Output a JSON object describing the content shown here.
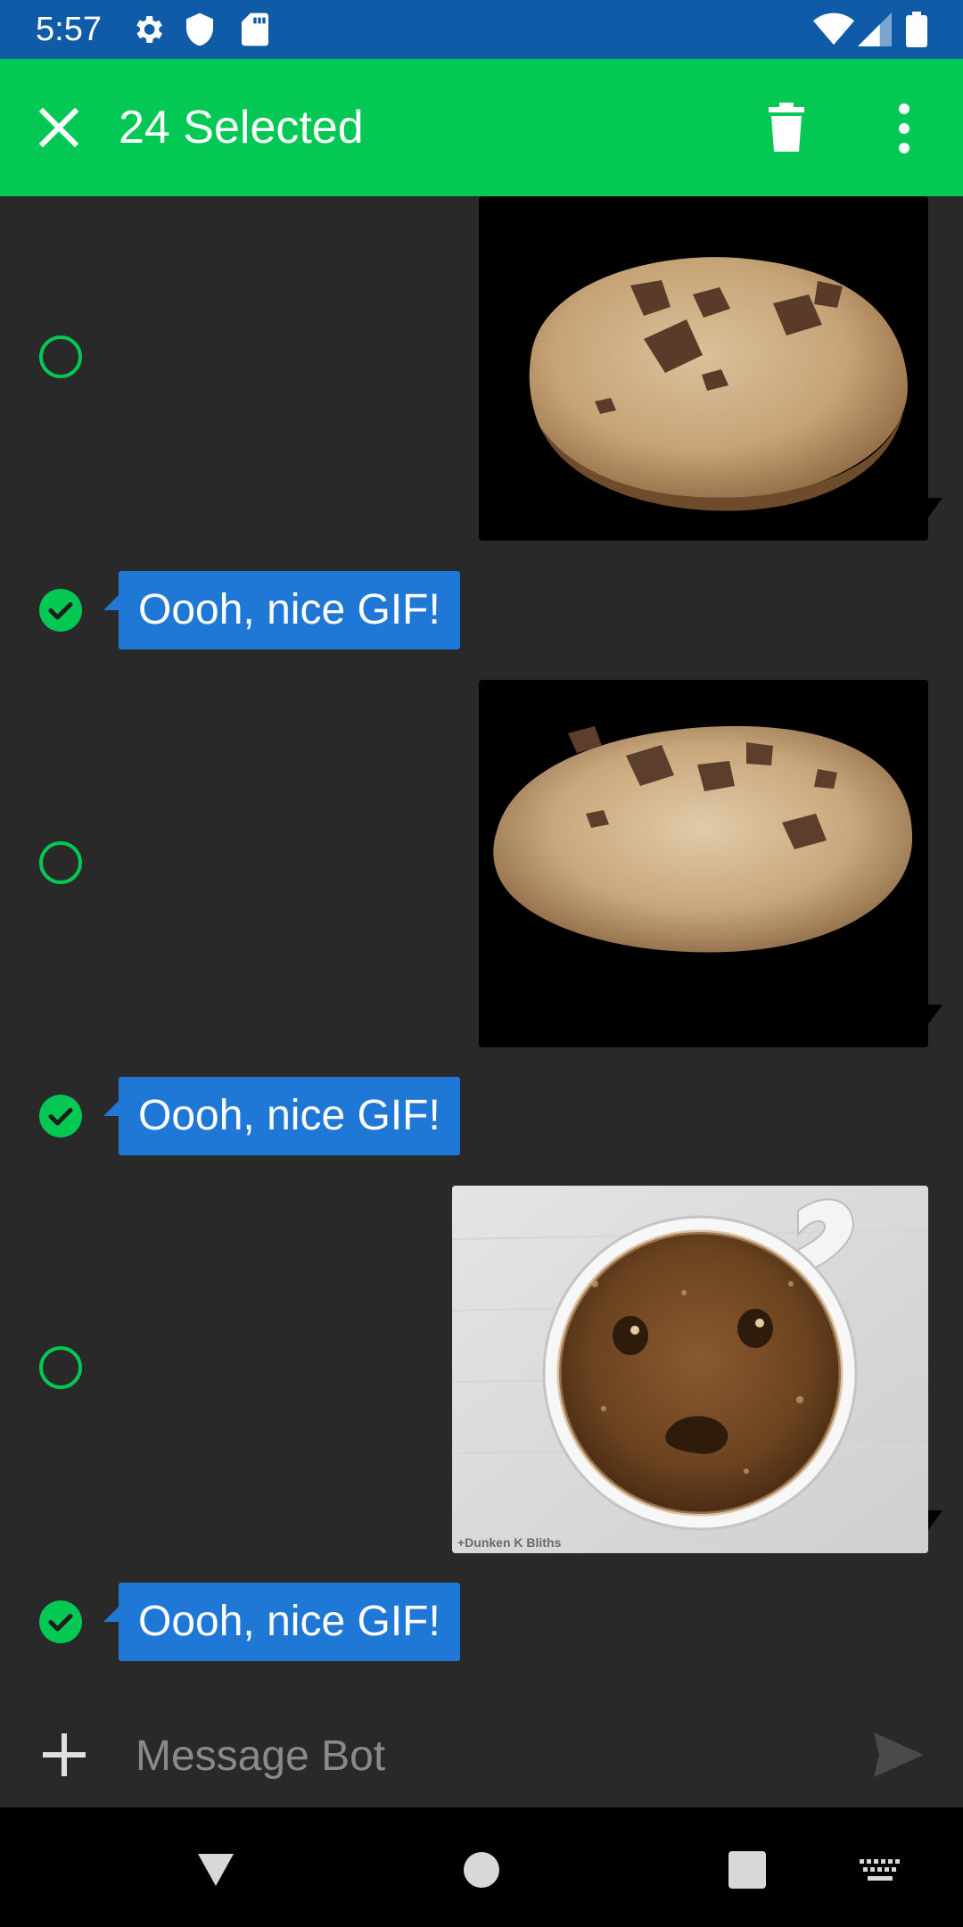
{
  "status_bar": {
    "time": "5:57",
    "icons": [
      "gear-icon",
      "shield-icon",
      "sd-card-icon",
      "wifi-icon",
      "signal-icon",
      "battery-icon"
    ]
  },
  "app_bar": {
    "title": "24 Selected",
    "close_icon": "close-icon",
    "delete_icon": "trash-icon",
    "menu_icon": "more-vertical-icon"
  },
  "messages": [
    {
      "type": "gif",
      "subject": "cookie",
      "selected": false
    },
    {
      "type": "text",
      "text": "Oooh, nice GIF!",
      "selected": true
    },
    {
      "type": "gif",
      "subject": "cookie",
      "selected": false
    },
    {
      "type": "text",
      "text": "Oooh, nice GIF!",
      "selected": true
    },
    {
      "type": "gif",
      "subject": "coffee-face",
      "selected": false,
      "watermark": "+Dunken K Bliths"
    },
    {
      "type": "text",
      "text": "Oooh, nice GIF!",
      "selected": true
    }
  ],
  "composer": {
    "placeholder": "Message Bot",
    "add_icon": "plus-icon",
    "send_icon": "send-icon"
  },
  "colors": {
    "status_bar": "#0f5ba8",
    "app_bar": "#03c853",
    "background": "#292929",
    "bubble": "#1f77d6",
    "accent": "#03c853"
  }
}
